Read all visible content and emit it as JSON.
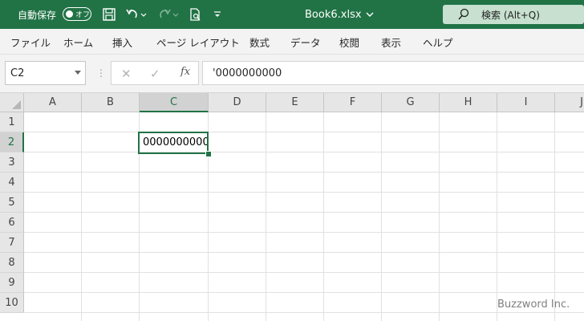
{
  "titlebar": {
    "autosave_label": "自動保存",
    "autosave_state": "オフ",
    "document_title": "Book6.xlsx",
    "search_placeholder": "検索 (Alt+Q)"
  },
  "ribbon": {
    "tabs": [
      "ファイル",
      "ホーム",
      "挿入",
      "ページ レイアウト",
      "数式",
      "データ",
      "校閲",
      "表示",
      "ヘルプ"
    ]
  },
  "formula_bar": {
    "name_box": "C2",
    "fx_label": "fx",
    "formula": "'0000000000"
  },
  "grid": {
    "columns": [
      "A",
      "B",
      "C",
      "D",
      "E",
      "F",
      "G",
      "H",
      "I",
      "J"
    ],
    "rows": [
      "1",
      "2",
      "3",
      "4",
      "5",
      "6",
      "7",
      "8",
      "9",
      "10"
    ],
    "active_cell": "C2",
    "cells": {
      "C2": "0000000000"
    }
  },
  "watermark": "Buzzword Inc.",
  "colors": {
    "accent": "#217346",
    "header_bg": "#e6e6e6"
  }
}
